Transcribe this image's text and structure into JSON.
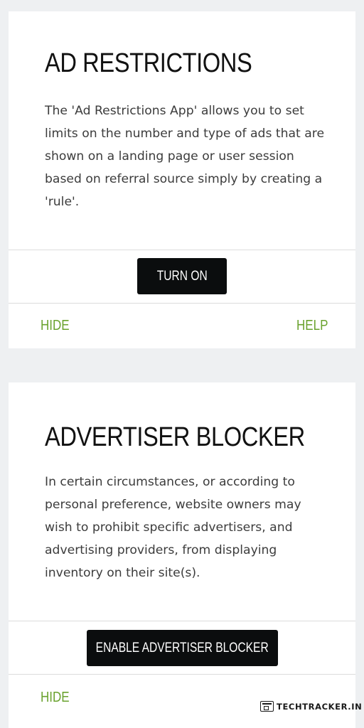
{
  "cards": [
    {
      "title": "AD RESTRICTIONS",
      "description": "The 'Ad Restrictions App' allows you to set limits on the number and type of ads that are shown on a landing page or user session based on referral source simply by creating a 'rule'.",
      "action_label": "TURN ON",
      "hide_label": "HIDE",
      "help_label": "HELP"
    },
    {
      "title": "ADVERTISER BLOCKER",
      "description": "In certain circumstances, or according to personal preference, website owners may wish to prohibit specific advertisers, and advertising providers, from displaying inventory on their site(s).",
      "action_label": "ENABLE ADVERTISER BLOCKER",
      "hide_label": "HIDE"
    }
  ],
  "watermark": {
    "text": "TECHTRACKER.IN"
  },
  "colors": {
    "background": "#eef0f2",
    "card": "#ffffff",
    "button": "#0b0d0e",
    "link": "#6aa22e"
  }
}
